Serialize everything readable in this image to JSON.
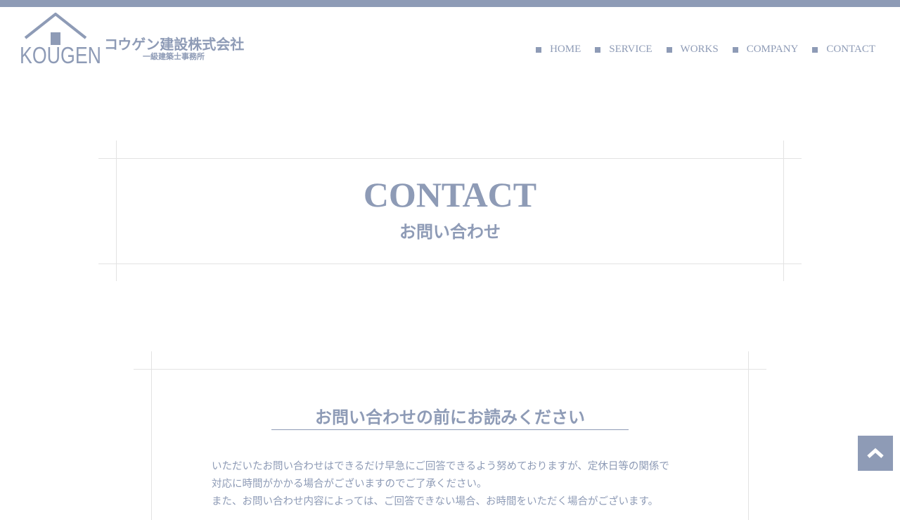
{
  "header": {
    "logo": {
      "wordmark": "KOUGEN",
      "company_name": "コウゲン建設株式会社",
      "company_subtitle": "一級建築士事務所"
    },
    "nav": [
      {
        "label": "HOME",
        "icon": "square-bullet-icon"
      },
      {
        "label": "SERVICE",
        "icon": "square-bullet-icon"
      },
      {
        "label": "WORKS",
        "icon": "square-bullet-icon"
      },
      {
        "label": "COMPANY",
        "icon": "square-bullet-icon"
      },
      {
        "label": "CONTACT",
        "icon": "square-bullet-icon"
      }
    ]
  },
  "page": {
    "title": "CONTACT",
    "subtitle": "お問い合わせ"
  },
  "notice": {
    "title": "お問い合わせの前にお読みください",
    "lines": [
      "いただいたお問い合わせはできるだけ早急にご回答できるよう努めておりますが、定休日等の関係で",
      "対応に時間がかかる場合がございますのでご了承ください。",
      "また、お問い合わせ内容によっては、ご回答できない場合、お時間をいただく場合がございます。"
    ]
  },
  "back_to_top": {
    "icon": "chevron-up-icon"
  },
  "colors": {
    "accent": "#8e9bb6",
    "rule": "#e3e3e3",
    "background": "#ffffff"
  }
}
